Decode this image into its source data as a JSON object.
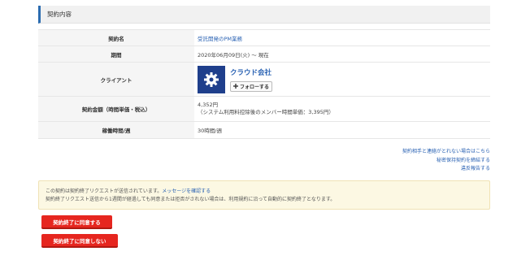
{
  "section": {
    "title": "契約内容"
  },
  "contract": {
    "rows": {
      "name": {
        "label": "契約名",
        "value": "受託開発のPM業務"
      },
      "period": {
        "label": "期間",
        "value": "2020年06月09日(火) 〜 現在"
      },
      "client": {
        "label": "クライアント",
        "name": "クラウド会社",
        "follow_label": "フォローする",
        "follow_icon": "plus-icon"
      },
      "fee": {
        "label": "契約金額（時間単価・税込）",
        "value": "4,352円",
        "note": "（システム利用料控除後のメンバー時間単価：3,395円）"
      },
      "hours": {
        "label": "稼働時間/週",
        "value": "30時間/週"
      }
    }
  },
  "side_links": {
    "contact": "契約相手と連絡がとれない場合はこちら",
    "nda": "秘密保持契約を締結する",
    "report": "違反報告する"
  },
  "notice": {
    "line1_text": "この契約は契約終了リクエストが送信されています。",
    "line1_link": "メッセージを確認する",
    "line2": "契約終了リクエスト送信から1週間が経過しても同意または拒否がされない場合は、利用規約に沿って自動的に契約終了となります。"
  },
  "buttons": {
    "agree": "契約終了に同意する",
    "disagree": "契約終了に同意しない"
  },
  "colors": {
    "accent": "#2b6cb0",
    "link": "#2a62b3",
    "danger": "#e6261f",
    "notice_bg": "#fcf8e3"
  }
}
